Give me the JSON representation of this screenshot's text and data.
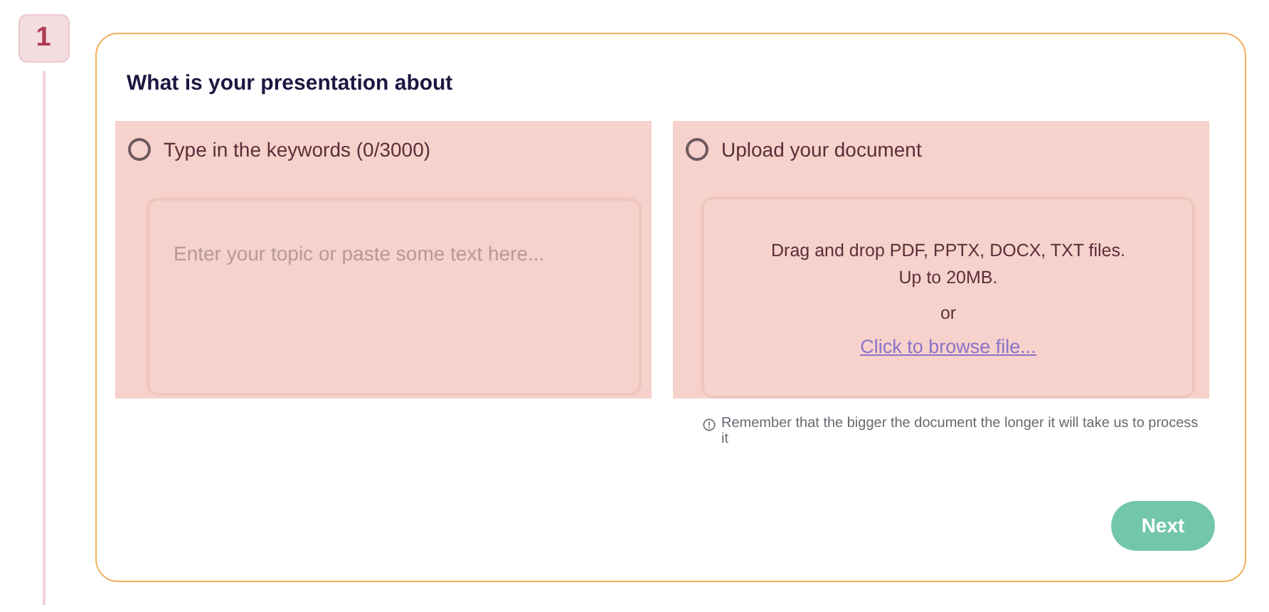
{
  "step": {
    "number": "1"
  },
  "form": {
    "title": "What is your presentation about",
    "options": [
      {
        "kind": "text",
        "label": "Type in the keywords (0/3000)",
        "selected": false,
        "placeholder": "Enter your topic or paste some text here..."
      },
      {
        "kind": "upload",
        "label": "Upload your document",
        "selected": false,
        "drop_text": "Drag and drop PDF, PPTX, DOCX, TXT files.\nUp to 20MB.",
        "or": "or",
        "browse_link": "Click to browse file...",
        "note": "Remember that the bigger the document the longer it will take us to process it"
      }
    ],
    "next_button": "Next"
  }
}
